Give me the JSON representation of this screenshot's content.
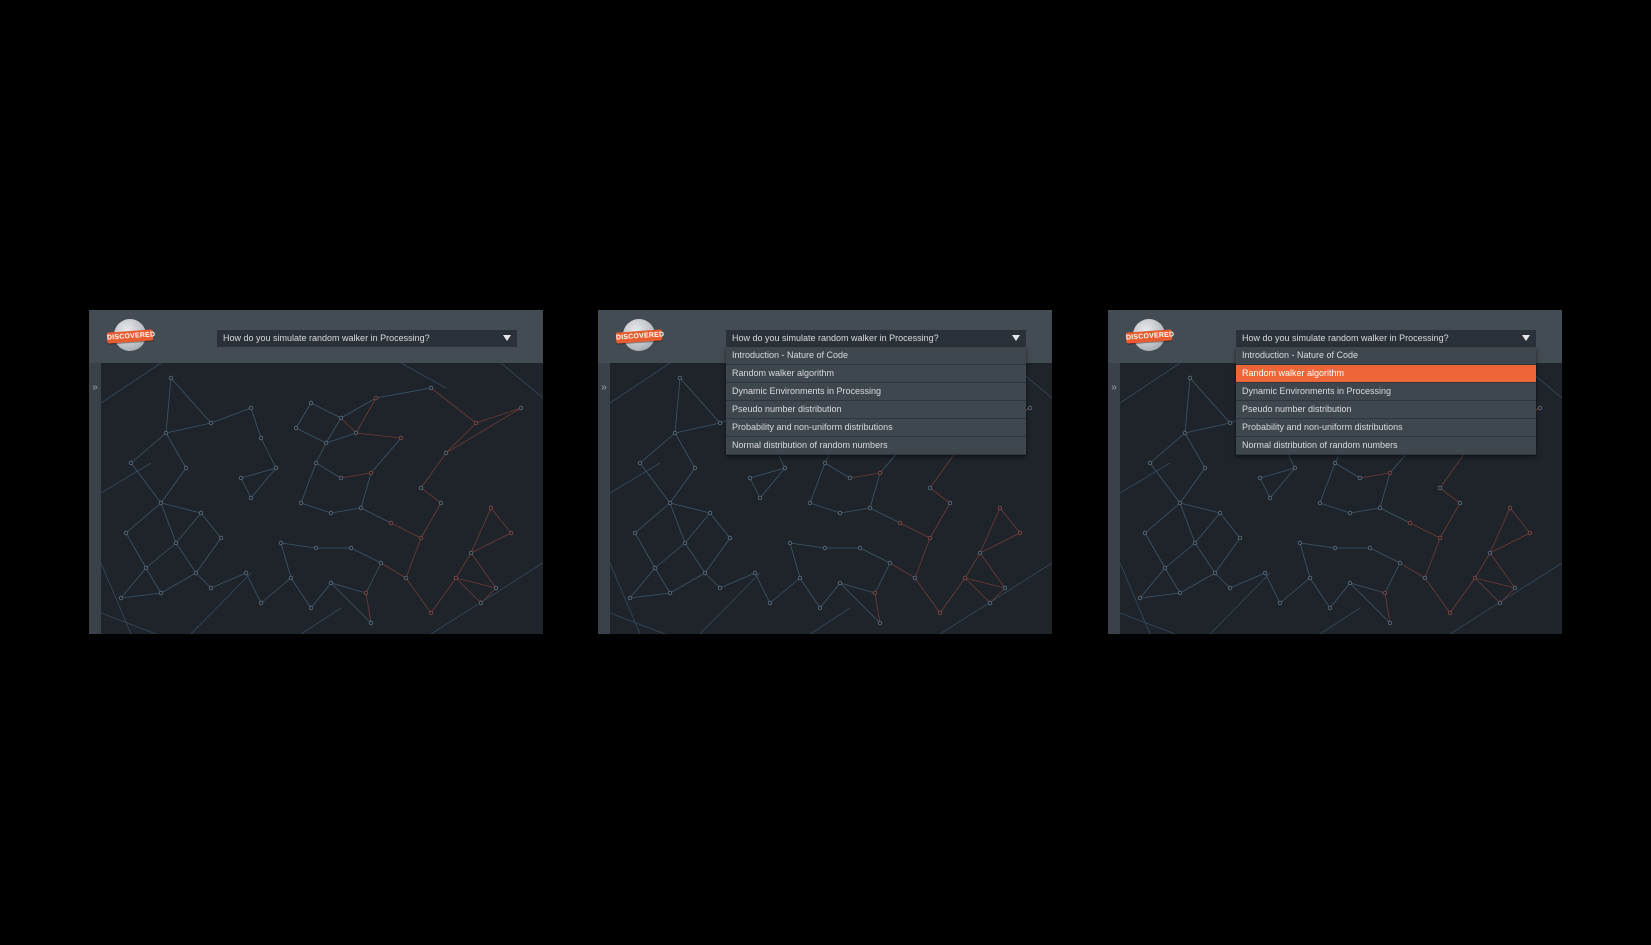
{
  "colors": {
    "background": "#000000",
    "topbar": "#434b53",
    "canvas": "#1f242b",
    "accent": "#ee6537",
    "edge": "#3f5566",
    "edge_red": "#6e3a37"
  },
  "logo": {
    "text": "DISCOVERED"
  },
  "question": "How do you simulate random walker in Processing?",
  "sidebar": {
    "expand_icon": "double-chevron-right-icon"
  },
  "options": [
    "Introduction - Nature of Code",
    "Random walker algorithm",
    "Dynamic Environments in Processing",
    "Pseudo number distribution",
    "Probability and non-uniform distributions",
    "Normal distribution of random numbers"
  ],
  "panels": [
    {
      "dropdown_open": false,
      "highlighted_index": -1
    },
    {
      "dropdown_open": true,
      "highlighted_index": -1
    },
    {
      "dropdown_open": true,
      "highlighted_index": 1
    }
  ]
}
